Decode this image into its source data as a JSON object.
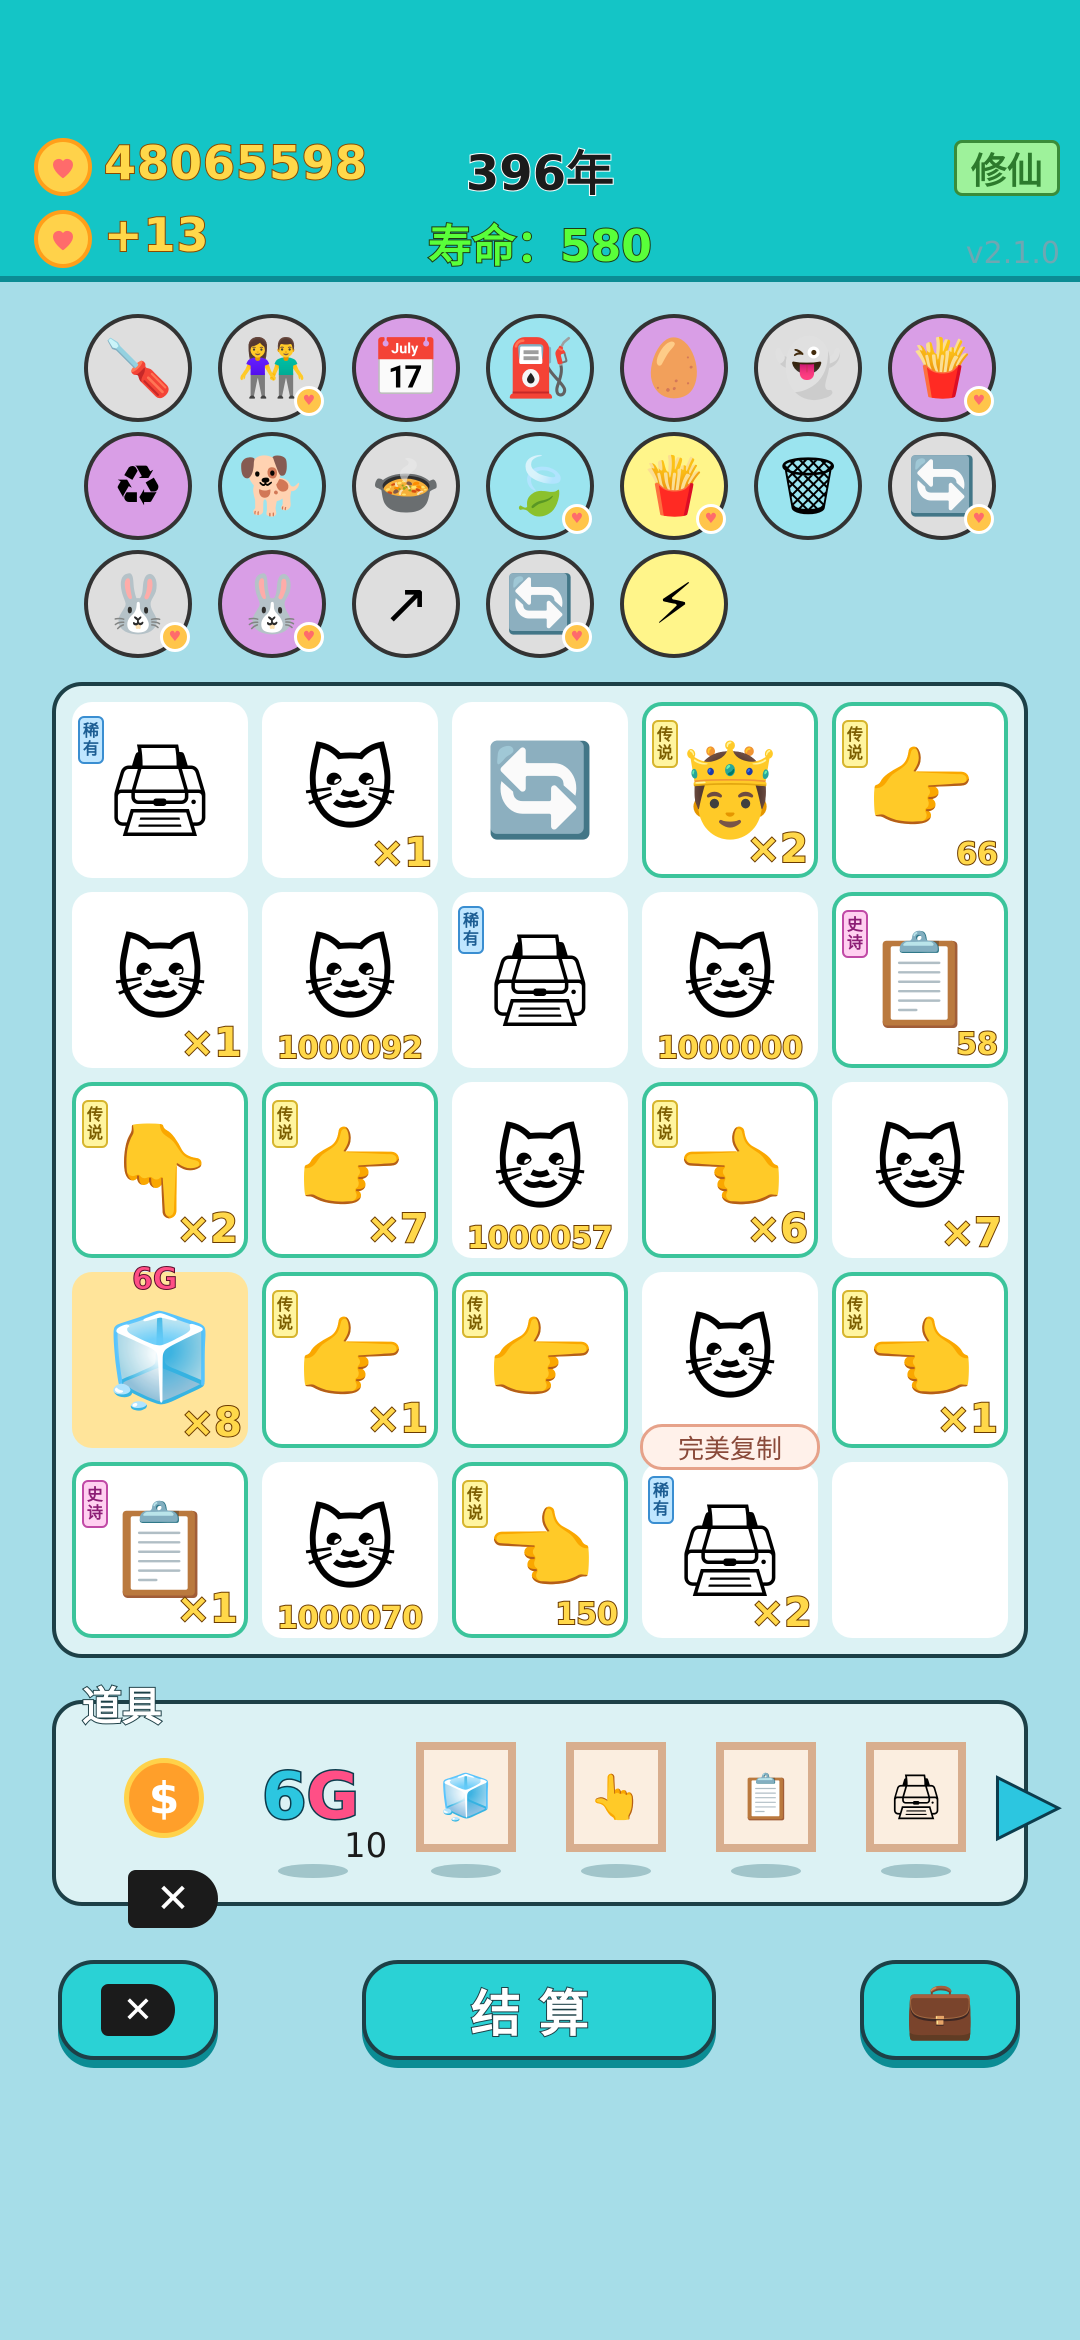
{
  "header": {
    "coins": "48065598",
    "coin_gain": "+13",
    "year": "396年",
    "lifespan": "寿命：580",
    "cultivate_button": "修仙",
    "version": "v2.1.0"
  },
  "items_grid": [
    {
      "icon": "screwdriver-icon",
      "glyph": "🪛",
      "bg": "gray",
      "heart": false
    },
    {
      "icon": "couple-icon",
      "glyph": "👫",
      "bg": "gray",
      "heart": true
    },
    {
      "icon": "calendar-icon",
      "glyph": "📅",
      "bg": "purple",
      "heart": false
    },
    {
      "icon": "pump-icon",
      "glyph": "⛽",
      "bg": "blue",
      "heart": false
    },
    {
      "icon": "egg-icon",
      "glyph": "🥚",
      "bg": "purple",
      "heart": false
    },
    {
      "icon": "ghost-icon",
      "glyph": "👻",
      "bg": "gray",
      "heart": false
    },
    {
      "icon": "fries-icon",
      "glyph": "🍟",
      "bg": "purple",
      "heart": true
    },
    {
      "icon": "recycle-icon",
      "glyph": "♻",
      "bg": "purple",
      "heart": false
    },
    {
      "icon": "dog-icon",
      "glyph": "🐕",
      "bg": "blue",
      "heart": false
    },
    {
      "icon": "pot-icon",
      "glyph": "🍲",
      "bg": "gray",
      "heart": false
    },
    {
      "icon": "leaf-icon",
      "glyph": "🍃",
      "bg": "blue",
      "heart": true
    },
    {
      "icon": "fries-icon",
      "glyph": "🍟",
      "bg": "yellow",
      "heart": true
    },
    {
      "icon": "trash-bag-icon",
      "glyph": "🗑",
      "bg": "blue",
      "heart": false
    },
    {
      "icon": "refresh-icon",
      "glyph": "🔄",
      "bg": "gray",
      "heart": true
    },
    {
      "icon": "rabbit-icon",
      "glyph": "🐰",
      "bg": "gray",
      "heart": true
    },
    {
      "icon": "rabbit-icon",
      "glyph": "🐰",
      "bg": "purple",
      "heart": true
    },
    {
      "icon": "arrow-up-icon",
      "glyph": "↗",
      "bg": "gray",
      "heart": false
    },
    {
      "icon": "refresh-icon",
      "glyph": "🔄",
      "bg": "gray",
      "heart": true
    },
    {
      "icon": "lightning-icon",
      "glyph": "⚡",
      "bg": "yellow",
      "heart": false
    }
  ],
  "board": [
    {
      "kind": "printer",
      "glyph": "🖨",
      "tag": "稀有",
      "tag_type": "xi",
      "count": "",
      "legend": false
    },
    {
      "kind": "cat",
      "glyph": "🐱",
      "tag": "",
      "tag_type": "",
      "count": "×1",
      "legend": false
    },
    {
      "kind": "cycle-bowl",
      "glyph": "🔄",
      "tag": "",
      "tag_type": "",
      "count": "",
      "legend": false
    },
    {
      "kind": "king-face",
      "glyph": "🤴",
      "tag": "传说",
      "tag_type": "chuan",
      "count": "×2",
      "legend": true
    },
    {
      "kind": "hand",
      "glyph": "👉",
      "tag": "传说",
      "tag_type": "chuan",
      "count": "66",
      "legend": true
    },
    {
      "kind": "cat",
      "glyph": "🐱",
      "tag": "",
      "tag_type": "",
      "count": "×1",
      "legend": false
    },
    {
      "kind": "cat",
      "glyph": "🐱",
      "tag": "",
      "tag_type": "",
      "count": "1000092",
      "legend": false
    },
    {
      "kind": "printer",
      "glyph": "🖨",
      "tag": "稀有",
      "tag_type": "xi",
      "count": "",
      "legend": false
    },
    {
      "kind": "cat",
      "glyph": "🐱",
      "tag": "",
      "tag_type": "",
      "count": "1000000",
      "legend": false
    },
    {
      "kind": "copy",
      "glyph": "📋",
      "tag": "史诗",
      "tag_type": "shi",
      "count": "58",
      "legend": true
    },
    {
      "kind": "hand",
      "glyph": "👇",
      "tag": "传说",
      "tag_type": "chuan",
      "count": "×2",
      "legend": true
    },
    {
      "kind": "hand",
      "glyph": "👉",
      "tag": "传说",
      "tag_type": "chuan",
      "count": "×7",
      "legend": true
    },
    {
      "kind": "cat",
      "glyph": "🐱",
      "tag": "",
      "tag_type": "",
      "count": "1000057",
      "legend": false
    },
    {
      "kind": "hand",
      "glyph": "👈",
      "tag": "传说",
      "tag_type": "chuan",
      "count": "×6",
      "legend": true
    },
    {
      "kind": "cat",
      "glyph": "🐱",
      "tag": "",
      "tag_type": "",
      "count": "×7",
      "legend": false
    },
    {
      "kind": "fridge",
      "glyph": "🧊",
      "tag": "",
      "tag_type": "",
      "count": "×8",
      "legend": false
    },
    {
      "kind": "hand",
      "glyph": "👉",
      "tag": "传说",
      "tag_type": "chuan",
      "count": "×1",
      "legend": true
    },
    {
      "kind": "hand",
      "glyph": "👉",
      "tag": "传说",
      "tag_type": "chuan",
      "count": "",
      "legend": true
    },
    {
      "kind": "cat",
      "glyph": "🐱",
      "tag": "",
      "tag_type": "",
      "count": "",
      "legend": false
    },
    {
      "kind": "hand",
      "glyph": "👈",
      "tag": "传说",
      "tag_type": "chuan",
      "count": "×1",
      "legend": true
    },
    {
      "kind": "copy",
      "glyph": "📋",
      "tag": "史诗",
      "tag_type": "shi",
      "count": "×1",
      "legend": true
    },
    {
      "kind": "cat",
      "glyph": "🐱",
      "tag": "",
      "tag_type": "",
      "count": "1000070",
      "legend": false
    },
    {
      "kind": "hand",
      "glyph": "👈",
      "tag": "传说",
      "tag_type": "chuan",
      "count": "150",
      "legend": true
    },
    {
      "kind": "printer",
      "glyph": "🖨",
      "tag": "稀有",
      "tag_type": "xi",
      "count": "×2",
      "legend": false
    },
    {
      "kind": "empty",
      "glyph": "",
      "tag": "",
      "tag_type": "",
      "count": "",
      "legend": false
    }
  ],
  "fridge_label": "6G",
  "perfect_copy_bubble": "完美复制",
  "props": {
    "title": "道具",
    "coin_symbol": "$",
    "sixg_six": "6",
    "sixg_g": "G",
    "sixg_count": "10",
    "frames": [
      {
        "icon": "fridge-icon",
        "glyph": "🧊"
      },
      {
        "icon": "hand-icon",
        "glyph": "👆"
      },
      {
        "icon": "copy-icon",
        "glyph": "📋"
      },
      {
        "icon": "printer-icon",
        "glyph": "🖨"
      }
    ],
    "next_arrow": "▶"
  },
  "buttons": {
    "delete": "✕",
    "settle": "结算",
    "bag_icon": "💼"
  },
  "colors": {
    "header_bg": "#14c5c6",
    "page_bg": "#a6dde8",
    "legend_border": "#3bc49b",
    "button_bg": "#2ad2d5"
  }
}
